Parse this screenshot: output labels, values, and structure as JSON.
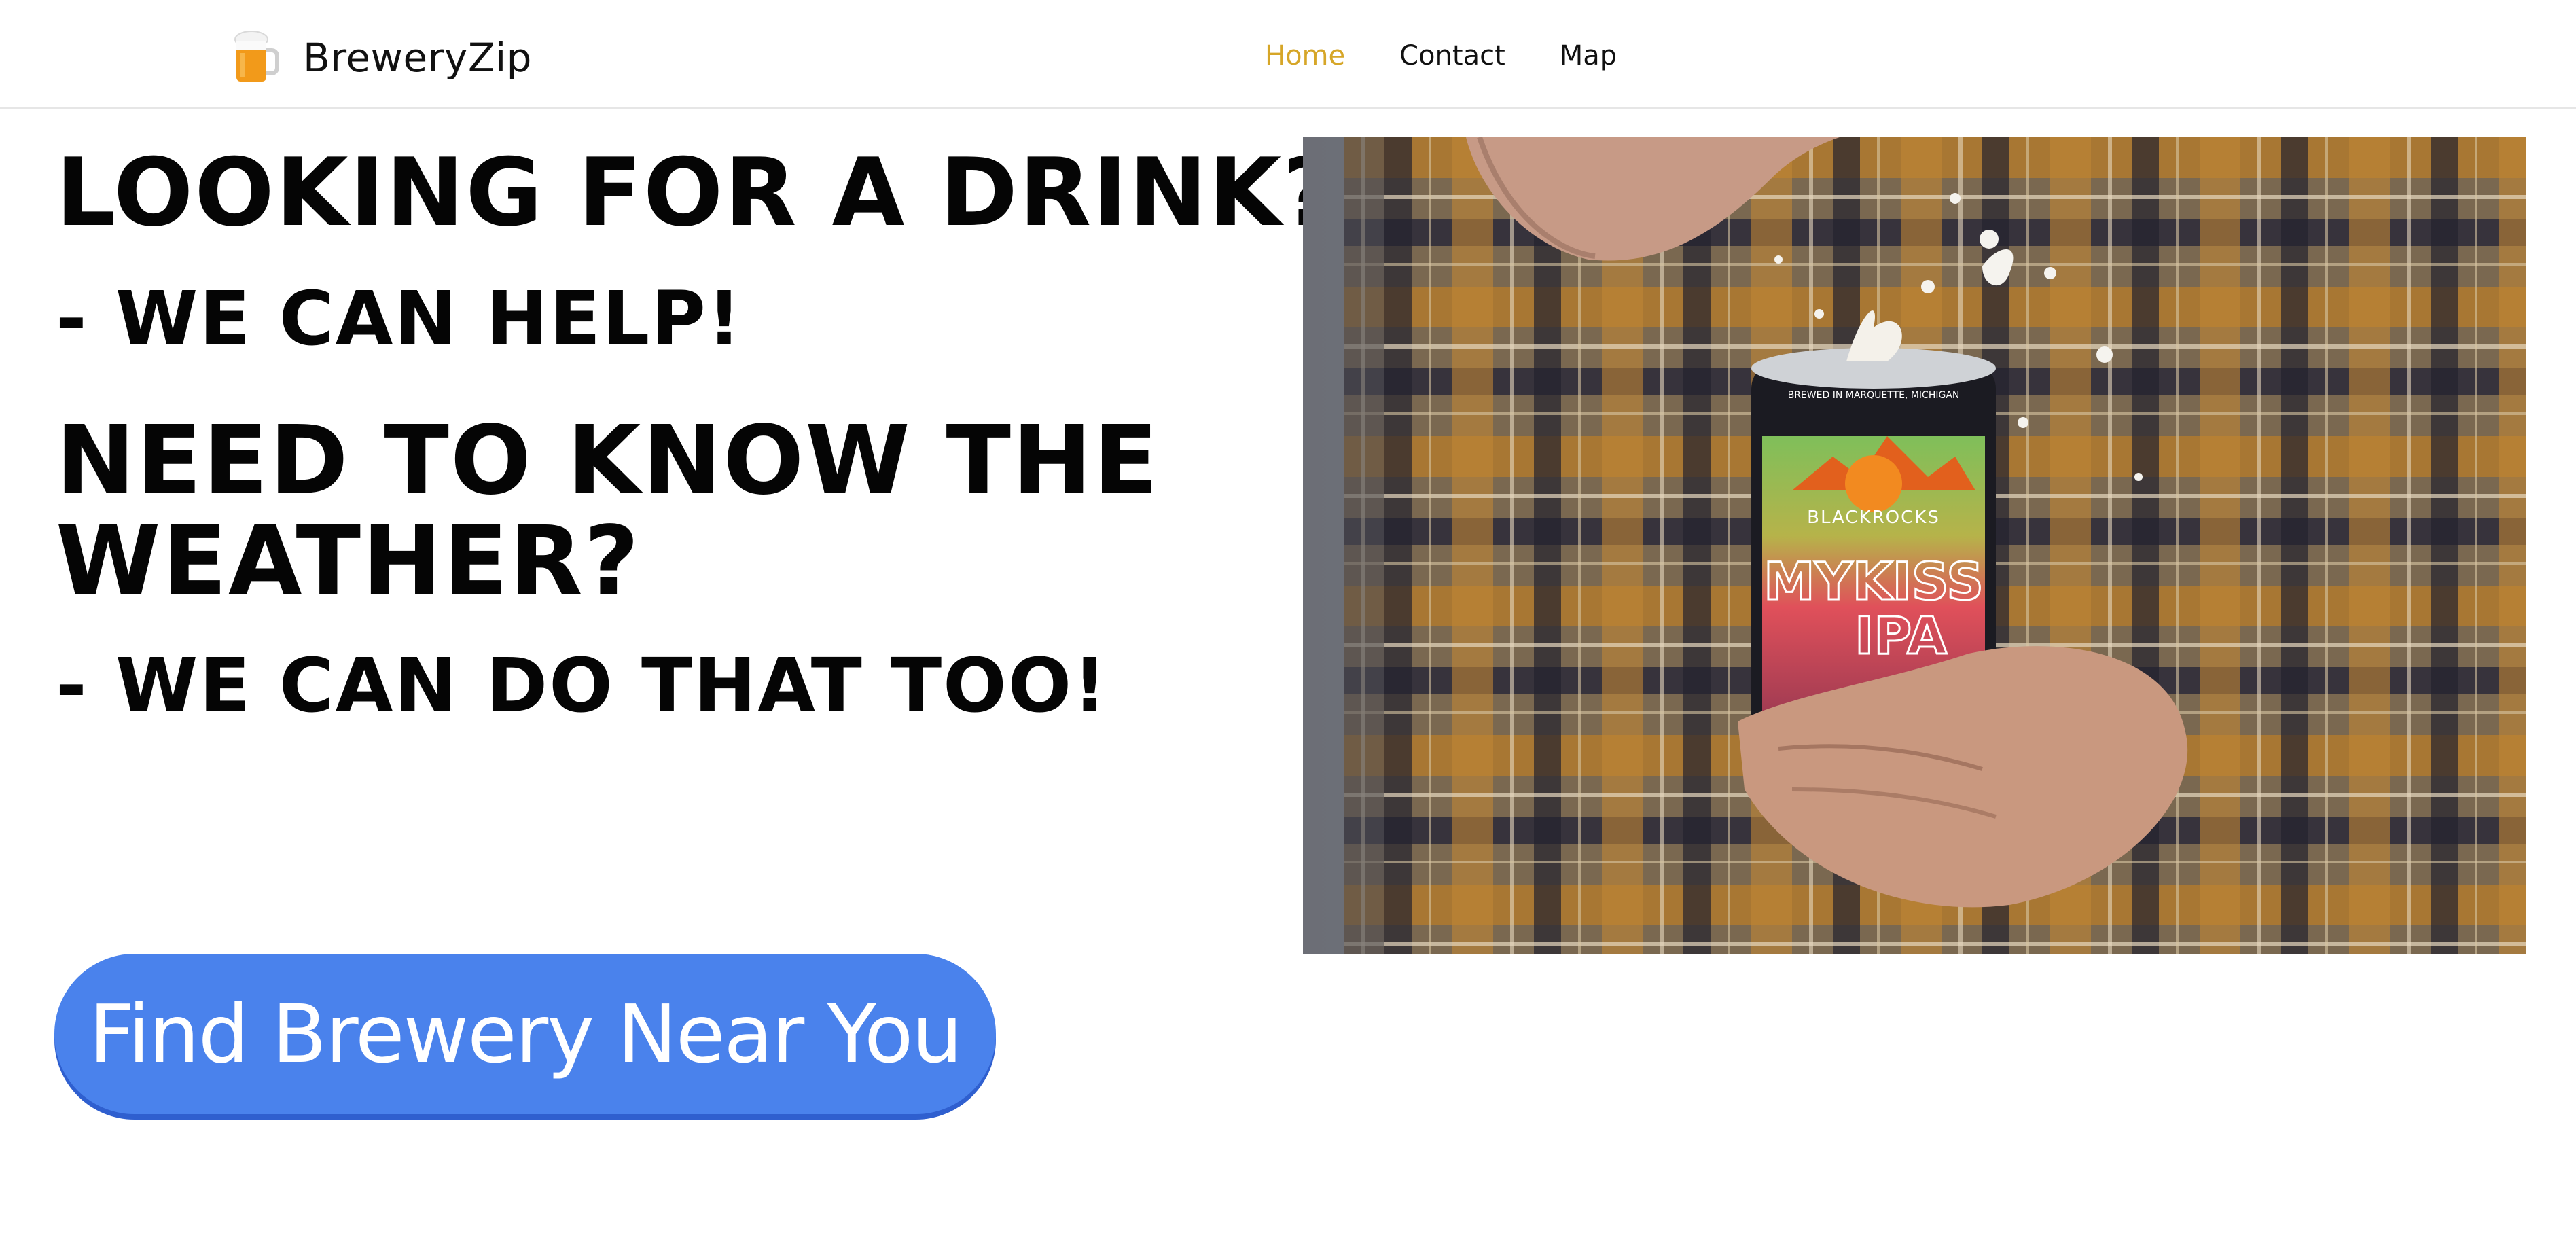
{
  "header": {
    "brand_icon": "beer-mug-icon",
    "brand_name": "BreweryZip",
    "nav": [
      {
        "label": "Home",
        "active": true
      },
      {
        "label": "Contact",
        "active": false
      },
      {
        "label": "Map",
        "active": false
      }
    ],
    "active_color": "#d6a628"
  },
  "hero": {
    "line1": "LOOKING FOR A DRINK?",
    "line2": "- WE CAN HELP!",
    "line3": "NEED TO KNOW THE WEATHER?",
    "line4": "- WE CAN DO THAT TOO!"
  },
  "cta": {
    "label": "Find Brewery Near You",
    "color": "#4a82ec"
  },
  "photo": {
    "subject": "hand-holding-beer-can-image",
    "can_text": {
      "brand": "BLACKROCKS",
      "name": "MYKISS",
      "style": "IPA",
      "tagline": "BREWED IN MARQUETTE, MICHIGAN"
    }
  }
}
